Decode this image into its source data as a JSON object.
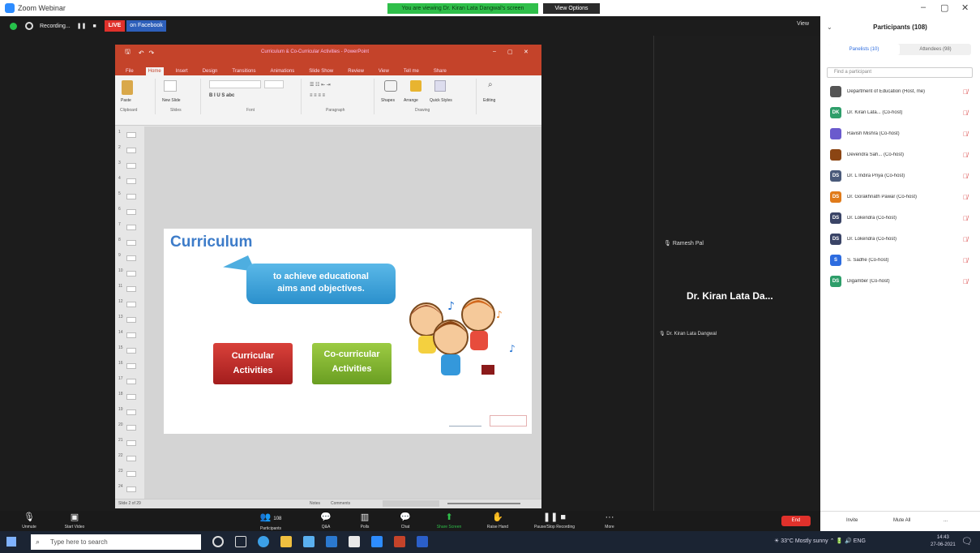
{
  "window": {
    "title": "Zoom Webinar",
    "share_banner": "You are viewing Dr. Kiran Lata Dangwal's screen",
    "view_options": "View Options",
    "min": "–",
    "max": "▢",
    "close": "✕"
  },
  "topbar": {
    "recording": "Recording...",
    "live": "LIVE",
    "facebook": "on Facebook",
    "view": "View"
  },
  "ppt": {
    "file_title": "Curriculum & Co-Curricular Activities - PowerPoint",
    "tabs": [
      "File",
      "Home",
      "Insert",
      "Design",
      "Transitions",
      "Animations",
      "Slide Show",
      "Review",
      "View",
      "Tell me",
      "Share"
    ],
    "groups": [
      "Clipboard",
      "Slides",
      "Font",
      "Paragraph",
      "Drawing",
      "Editing"
    ],
    "ribbon_labels": {
      "paste": "Paste",
      "new_slide": "New Slide",
      "shapes": "Shapes",
      "arrange": "Arrange",
      "quick_styles": "Quick Styles",
      "editing": "Editing"
    },
    "thumb_numbers": [
      "1",
      "2",
      "3",
      "4",
      "5",
      "6",
      "7",
      "8",
      "9",
      "10",
      "11",
      "12",
      "13",
      "14",
      "15",
      "16",
      "17",
      "18",
      "19",
      "20",
      "21",
      "22",
      "23",
      "24"
    ],
    "status_left": "Slide 2 of 29",
    "status_notes": "Notes",
    "status_comments": "Comments"
  },
  "slide": {
    "heading": "Curriculum",
    "callout_line1": "to achieve educational",
    "callout_line2": "aims and objectives.",
    "box_red_line1": "Curricular",
    "box_red_line2": "Activities",
    "box_green_line1": "Co-curricular",
    "box_green_line2": "Activities",
    "colors": {
      "heading": "#3d7cc9",
      "callout": "#3b9fd8",
      "red_box": "#c32d2a",
      "green_box": "#86b535"
    }
  },
  "speaker": {
    "muted_label": "Ramesh Pal",
    "big_name": "Dr. Kiran Lata Da...",
    "small_name": "Dr. Kiran Lata Dangwal"
  },
  "participants": {
    "title": "Participants (108)",
    "tab_panelists": "Panelists (10)",
    "tab_attendees": "Attendees (98)",
    "search_placeholder": "Find a participant",
    "rows": [
      {
        "initials": "",
        "name": "Department of Education (Host, me)",
        "color": "#555555"
      },
      {
        "initials": "DK",
        "name": "Dr. Kiran Lata... (Co-host)",
        "color": "#2e9e6a"
      },
      {
        "initials": "",
        "name": "Ravish Mishra (Co-host)",
        "color": "#6a5acd"
      },
      {
        "initials": "",
        "name": "Devendra Sah... (Co-host)",
        "color": "#8b4513"
      },
      {
        "initials": "DS",
        "name": "Dr. L Indira Priya (Co-host)",
        "color": "#4a5a7a"
      },
      {
        "initials": "DS",
        "name": "Dr. Gorakhnath Pawar (Co-host)",
        "color": "#e07b1a"
      },
      {
        "initials": "DS",
        "name": "Dr. Lokendra (Co-host)",
        "color": "#3a4466"
      },
      {
        "initials": "DS",
        "name": "Dr. Lokendra (Co-host)",
        "color": "#3a4466"
      },
      {
        "initials": "S",
        "name": "S. Sadhe (Co-host)",
        "color": "#2d6cdf"
      },
      {
        "initials": "DS",
        "name": "Digamber (Co-host)",
        "color": "#2e9e6a"
      }
    ],
    "footer_invite": "Invite",
    "footer_mute": "Mute All",
    "footer_more": "..."
  },
  "controls": {
    "unmute": "Unmute",
    "start_video": "Start Video",
    "participants": "Participants",
    "participants_count": "108",
    "q_and_a": "Q&A",
    "polls": "Polls",
    "chat": "Chat",
    "share_screen": "Share Screen",
    "raise_hand": "Raise Hand",
    "pause_recording": "Pause/Stop Recording",
    "more": "More",
    "end": "End"
  },
  "taskbar": {
    "search_placeholder": "Type here to search",
    "weather": "33°C  Mostly sunny",
    "lang": "ENG",
    "time": "14:43",
    "date": "27-06-2021"
  }
}
